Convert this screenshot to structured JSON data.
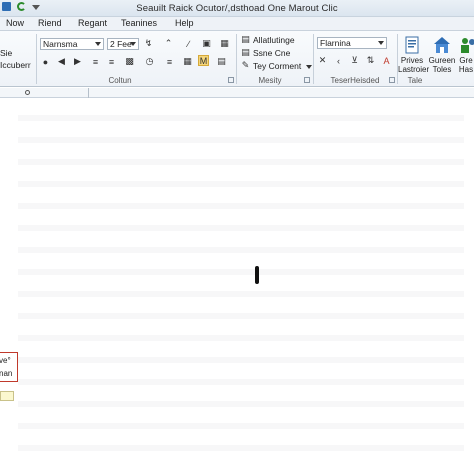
{
  "window": {
    "title": "Seauilt Raick Ocutor/,dsthoad One Marout Clic"
  },
  "menu": {
    "tabs": [
      "Now",
      "Riend",
      "Regant",
      "Teanines",
      "Help"
    ]
  },
  "ribbon": {
    "left_stub_top": "Sie",
    "left_stub_bottom": "Iccuberr",
    "font_name": "Narnsma",
    "font_size": "2 Fee",
    "group_font_label": "Coltun",
    "styles_items": [
      "Allatlutinge",
      "Ssne Cne",
      "Tey Corment"
    ],
    "group_styles_label": "Mesity",
    "style_combo": "Flarnina",
    "group_tese_label": "TeserHeisded",
    "big_buttons": [
      {
        "line1": "Prives",
        "line2": "Lastroier",
        "icon": "document-icon"
      },
      {
        "line1": "Gureen",
        "line2": "Toles",
        "icon": "house-icon"
      },
      {
        "line1": "Gre",
        "line2": "Has",
        "icon": "people-icon"
      }
    ],
    "group_tale_label": "Tale"
  },
  "document": {
    "callout_line1": "ve°",
    "callout_line2": "nan"
  },
  "colors": {
    "accent": "#2e6db4",
    "highlight": "#f5d67a",
    "callout_border": "#c0392b"
  }
}
